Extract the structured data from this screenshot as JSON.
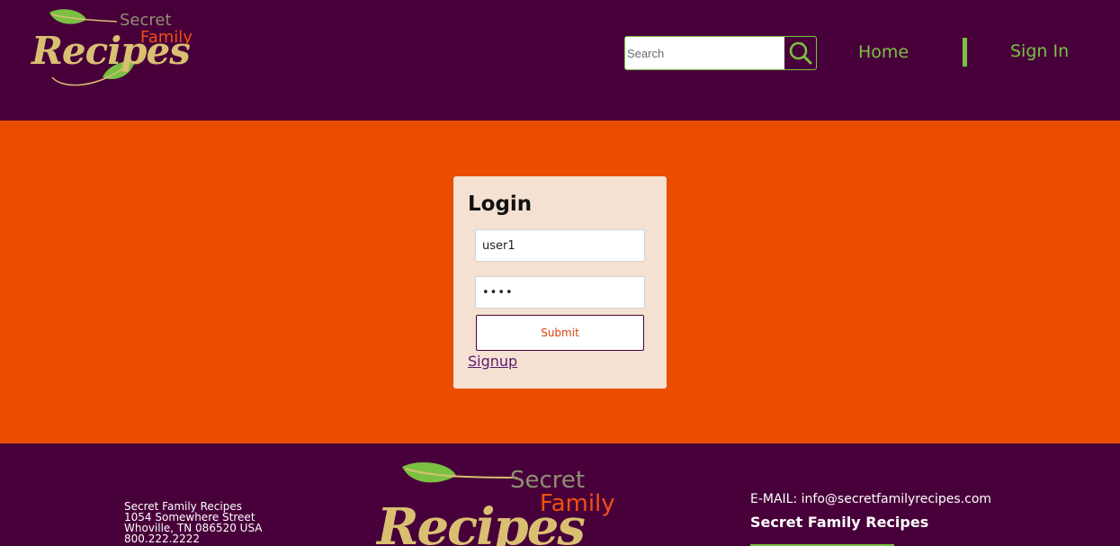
{
  "brand": {
    "word_secret": "Secret",
    "word_family": "Family",
    "word_recipes": "Recipes"
  },
  "header": {
    "search_placeholder": "Search",
    "search_icon": "search-icon",
    "nav_home": "Home",
    "nav_signin": "Sign In"
  },
  "login": {
    "title": "Login",
    "username_value": "user1",
    "password_value": "1234",
    "submit_label": "Submit",
    "signup_label": "Signup"
  },
  "footer": {
    "address_lines": [
      "Secret Family Recipes",
      "1054 Somewhere Street",
      "Whoville, TN 086520 USA",
      "800.222.2222"
    ],
    "email": "E-MAIL: info@secretfamilyrecipes.com",
    "company": "Secret Family Recipes"
  },
  "colors": {
    "header_bg": "#48003a",
    "main_bg": "#ea4c00",
    "accent_green": "#7ac143",
    "card_bg": "#f5e1d2",
    "recipes_gold": "#d9bf72",
    "family_orange": "#f0500f"
  }
}
